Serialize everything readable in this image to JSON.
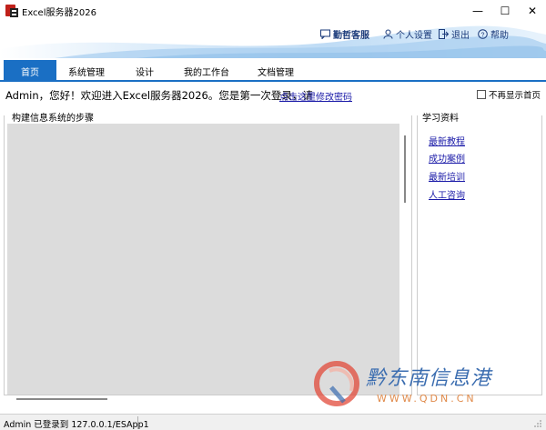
{
  "window": {
    "title": "Excel服务器2026",
    "minimize_glyph": "—",
    "maximize_glyph": "☐",
    "close_glyph": "✕"
  },
  "header": {
    "links": [
      {
        "label": "勤哲客服",
        "icon": "chat-icon"
      },
      {
        "label": "个人设置",
        "icon": "user-icon"
      },
      {
        "label": "退出",
        "icon": "logout-icon"
      },
      {
        "label": "帮助",
        "icon": "help-icon"
      }
    ]
  },
  "tabs": [
    {
      "label": "首页",
      "active": true
    },
    {
      "label": "系统管理",
      "active": false
    },
    {
      "label": "设计",
      "active": false
    },
    {
      "label": "我的工作台",
      "active": false
    },
    {
      "label": "文档管理",
      "active": false
    }
  ],
  "welcome": {
    "text": "Admin，您好！欢迎进入Excel服务器2026。您是第一次登录，请",
    "link": "点击这里修改密码",
    "checkbox_label": "不再显示首页",
    "checkbox_checked": false
  },
  "steps_panel": {
    "title": "构建信息系统的步骤"
  },
  "learn_panel": {
    "title": "学习资料",
    "links": [
      "最新教程",
      "成功案例",
      "最新培训",
      "人工咨询"
    ]
  },
  "watermark": {
    "text": "黔东南信息港",
    "url": "WWW.QDN.CN"
  },
  "statusbar": {
    "text": "Admin 已登录到 127.0.0.1/ESApp1"
  },
  "colors": {
    "accent": "#1a6fc4",
    "link": "#1a1aa8",
    "steps_area": "#dcdcdc"
  }
}
